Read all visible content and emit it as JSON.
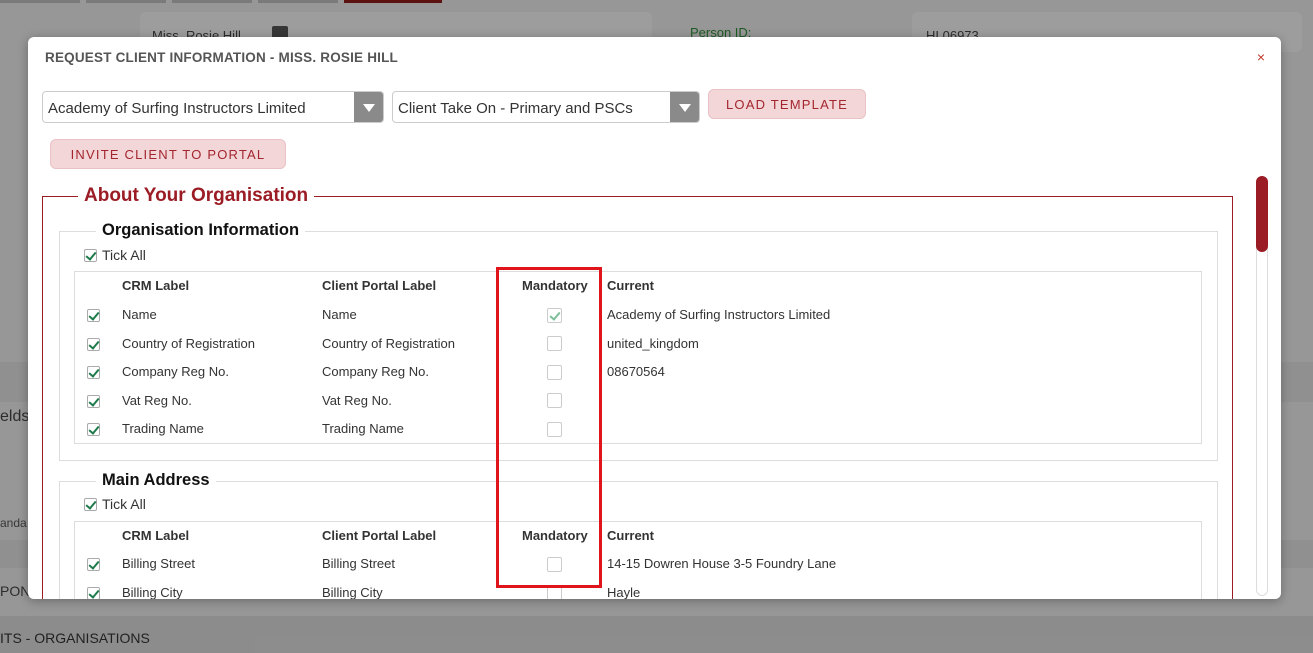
{
  "background": {
    "person_name": "Miss. Rosie Hill",
    "person_id_label": "Person ID:",
    "person_id_value": "HI 06973",
    "fields_fragment": "elds",
    "standa_fragment": "anda",
    "pon_fragment": "PON",
    "orgs_fragment": "ITS - ORGANISATIONS"
  },
  "modal": {
    "title": "REQUEST CLIENT INFORMATION - MISS. ROSIE HILL",
    "close_label": "×",
    "client_select": "Academy of Surfing Instructors Limited",
    "template_select": "Client Take On - Primary and PSCs",
    "load_template_label": "LOAD TEMPLATE",
    "invite_label": "INVITE CLIENT TO PORTAL"
  },
  "about": {
    "legend": "About Your Organisation"
  },
  "columns": {
    "crm": "CRM Label",
    "portal": "Client Portal Label",
    "mandatory": "Mandatory",
    "current": "Current"
  },
  "org_info": {
    "legend": "Organisation Information",
    "tick_all": "Tick All",
    "tick_all_checked": true,
    "rows": [
      {
        "selected": true,
        "crm": "Name",
        "portal": "Name",
        "mandatory": true,
        "current": "Academy of Surfing Instructors Limited"
      },
      {
        "selected": true,
        "crm": "Country of Registration",
        "portal": "Country of Registration",
        "mandatory": false,
        "current": "united_kingdom"
      },
      {
        "selected": true,
        "crm": "Company Reg No.",
        "portal": "Company Reg No.",
        "mandatory": false,
        "current": "08670564"
      },
      {
        "selected": true,
        "crm": "Vat Reg No.",
        "portal": "Vat Reg No.",
        "mandatory": false,
        "current": ""
      },
      {
        "selected": true,
        "crm": "Trading Name",
        "portal": "Trading Name",
        "mandatory": false,
        "current": ""
      }
    ]
  },
  "main_address": {
    "legend": "Main Address",
    "tick_all": "Tick All",
    "tick_all_checked": true,
    "rows": [
      {
        "selected": true,
        "crm": "Billing Street",
        "portal": "Billing Street",
        "mandatory": false,
        "current": "14-15 Dowren House 3-5 Foundry Lane"
      },
      {
        "selected": true,
        "crm": "Billing City",
        "portal": "Billing City",
        "mandatory": false,
        "current": "Hayle"
      }
    ]
  }
}
